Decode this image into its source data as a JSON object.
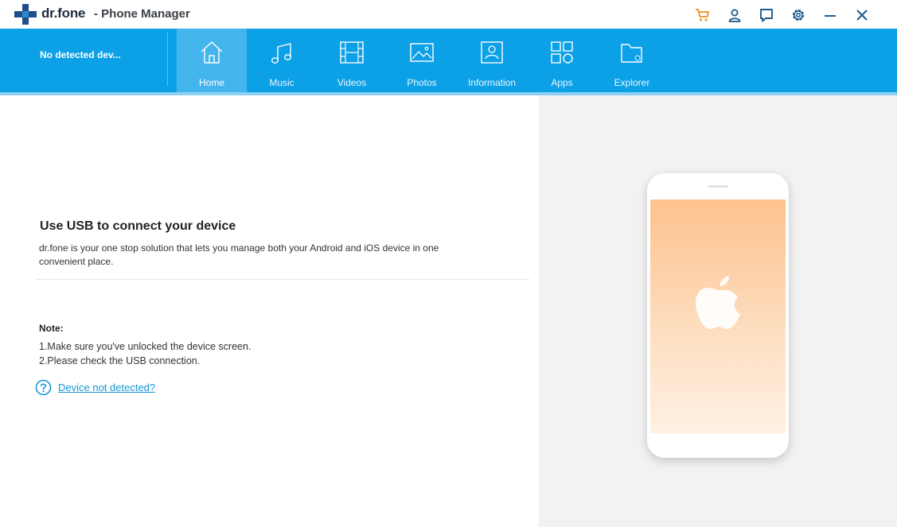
{
  "app": {
    "brand": "dr.fone",
    "title": "- Phone Manager"
  },
  "window_controls": {
    "icons": [
      "cart-icon",
      "user-icon",
      "feedback-icon",
      "settings-icon",
      "minimize-icon",
      "close-icon"
    ],
    "cart_color": "#f0901a",
    "icon_color": "#1f5a8c"
  },
  "nav": {
    "device_label": "No detected dev...",
    "bar_color": "#0ca0e6",
    "tabs": [
      {
        "label": "Home",
        "icon": "home-icon",
        "active": true
      },
      {
        "label": "Music",
        "icon": "music-icon",
        "active": false
      },
      {
        "label": "Videos",
        "icon": "video-icon",
        "active": false
      },
      {
        "label": "Photos",
        "icon": "photo-icon",
        "active": false
      },
      {
        "label": "Information",
        "icon": "contact-icon",
        "active": false
      },
      {
        "label": "Apps",
        "icon": "apps-icon",
        "active": false
      },
      {
        "label": "Explorer",
        "icon": "folder-icon",
        "active": false
      }
    ]
  },
  "main": {
    "heading": "Use USB to connect your device",
    "description": "dr.fone is your one stop solution that lets you manage both your Android and iOS device in one convenient place.",
    "note_title": "Note:",
    "notes": [
      "1.Make sure you've unlocked the device screen.",
      "2.Please check the USB connection."
    ],
    "help_link": "Device not detected?",
    "link_color": "#1596d6"
  },
  "device_illustration": {
    "icon": "apple-logo-icon"
  }
}
